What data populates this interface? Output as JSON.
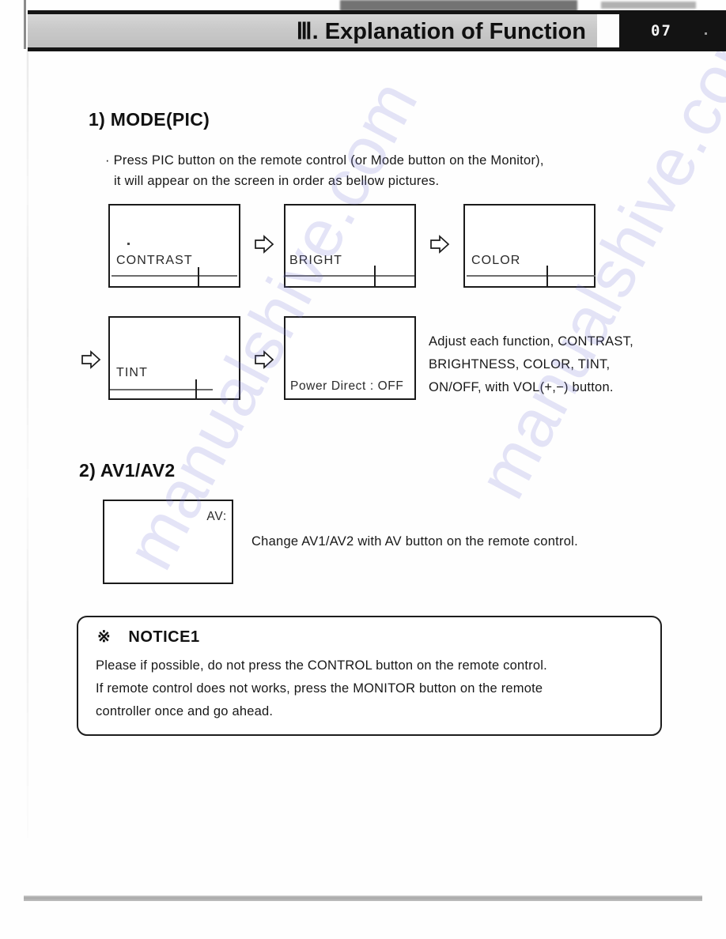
{
  "header": {
    "title": "Ⅲ. Explanation of Function",
    "page_number": "07"
  },
  "watermark": {
    "text_a": "manualshive.com",
    "text_b": "manualshive.com",
    "color": "#7878d7"
  },
  "sections": [
    {
      "heading": "1) MODE(PIC)",
      "intro_lines": [
        "· Press PIC button on the remote control (or Mode button on the Monitor),",
        "it will appear on the screen in order as bellow pictures."
      ],
      "osd_row1": [
        {
          "label": "CONTRAST",
          "slider": true
        },
        {
          "label": "BRIGHT",
          "slider": true
        },
        {
          "label": "COLOR",
          "slider": true
        }
      ],
      "osd_row2": [
        {
          "label": "TINT",
          "slider": true
        },
        {
          "label": "Power Direct : OFF",
          "slider": false
        }
      ],
      "note_lines": [
        "Adjust each function, CONTRAST,",
        "BRIGHTNESS, COLOR, TINT,",
        "ON/OFF, with VOL(+,−) button."
      ]
    },
    {
      "heading": "2) AV1/AV2",
      "osd": {
        "label": "AV:"
      },
      "note_lines": [
        "Change AV1/AV2 with AV button on the remote control."
      ]
    }
  ],
  "notice": {
    "symbol": "※",
    "title": "NOTICE1",
    "lines": [
      "Please if possible, do not press the CONTROL button on the remote control.",
      "If remote control does not works, press the MONITOR button on the remote",
      "controller once and go ahead."
    ]
  },
  "icons": {
    "arrow": "right-arrow-outline-icon"
  }
}
